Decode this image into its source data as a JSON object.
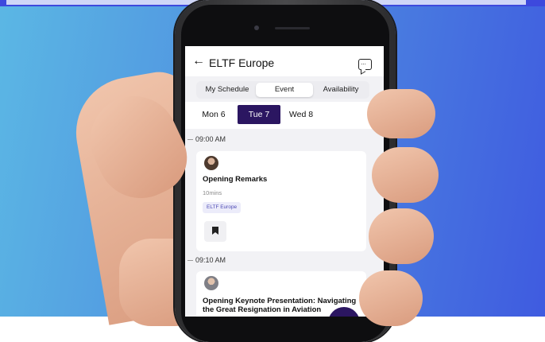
{
  "header": {
    "title": "ELTF Europe",
    "back_glyph": "←"
  },
  "tabs": [
    "My Schedule",
    "Event",
    "Availability"
  ],
  "days": [
    "Mon 6",
    "Tue 7",
    "Wed 8"
  ],
  "selected_day": "Tue 7",
  "sessions": [
    {
      "time": "09:00 AM",
      "title": "Opening Remarks",
      "duration": "10mins",
      "tag": "ELTF Europe"
    },
    {
      "time": "09:10 AM",
      "title": "Opening Keynote Presentation: Navigating the Great Resignation in Aviation"
    }
  ],
  "icons": {
    "chat": "chat-icon",
    "bookmark": "bookmark-icon",
    "back": "back-arrow-icon"
  },
  "colors": {
    "accent": "#2b1661",
    "tag_text": "#4e4bb5",
    "tag_bg": "#ececfa"
  }
}
